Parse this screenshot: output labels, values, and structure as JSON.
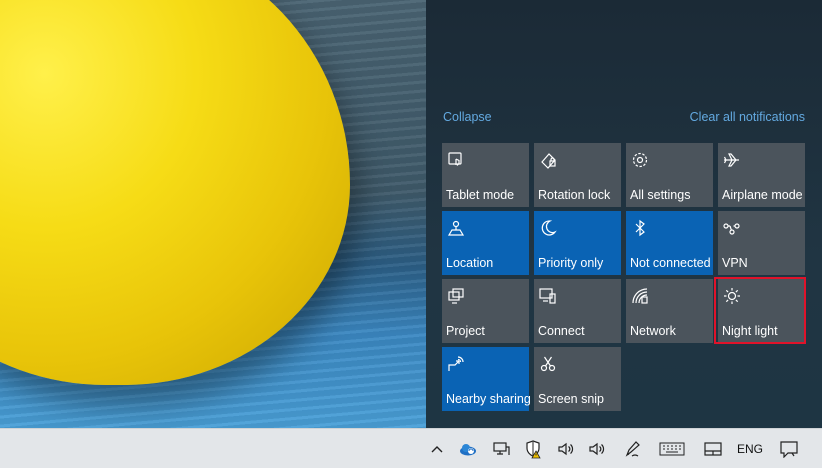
{
  "action_center": {
    "collapse_label": "Collapse",
    "clear_label": "Clear all notifications",
    "tiles": [
      {
        "label": "Tablet mode",
        "icon": "tablet-mode-icon",
        "state": "off"
      },
      {
        "label": "Rotation lock",
        "icon": "rotation-lock-icon",
        "state": "off"
      },
      {
        "label": "All settings",
        "icon": "gear-icon",
        "state": "off"
      },
      {
        "label": "Airplane mode",
        "icon": "airplane-icon",
        "state": "off"
      },
      {
        "label": "Location",
        "icon": "location-icon",
        "state": "on"
      },
      {
        "label": "Priority only",
        "icon": "moon-icon",
        "state": "on"
      },
      {
        "label": "Not connected",
        "icon": "bluetooth-icon",
        "state": "on"
      },
      {
        "label": "VPN",
        "icon": "vpn-icon",
        "state": "off"
      },
      {
        "label": "Project",
        "icon": "project-icon",
        "state": "off"
      },
      {
        "label": "Connect",
        "icon": "connect-icon",
        "state": "off"
      },
      {
        "label": "Network",
        "icon": "network-icon",
        "state": "off"
      },
      {
        "label": "Night light",
        "icon": "sun-icon",
        "state": "off"
      },
      {
        "label": "Nearby sharing",
        "icon": "nearby-sharing-icon",
        "state": "on"
      },
      {
        "label": "Screen snip",
        "icon": "screen-snip-icon",
        "state": "off"
      }
    ],
    "colors": {
      "tile_off": "#4b545c",
      "tile_on": "#0a63b4",
      "link": "#63a9e0",
      "highlight": "#e0132a"
    }
  },
  "taskbar": {
    "language": "ENG",
    "icons": [
      "chevron-up-icon",
      "onedrive-icon",
      "network-status-icon",
      "defender-warning-icon",
      "volume-icon",
      "speaker-icon",
      "pen-icon",
      "keyboard-icon",
      "touchpad-icon",
      "notification-icon"
    ]
  }
}
